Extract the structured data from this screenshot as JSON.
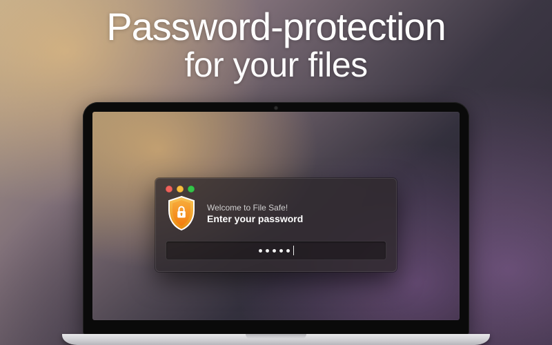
{
  "hero": {
    "line1": "Password-protection",
    "line2": "for your files"
  },
  "dialog": {
    "welcome": "Welcome to File Safe!",
    "prompt": "Enter your password",
    "password_mask_length": 5,
    "icon": "shield-lock-icon",
    "traffic": {
      "close": "red",
      "minimize": "yellow",
      "zoom": "green"
    }
  },
  "colors": {
    "shield_outer": "#f6a11c",
    "shield_inner": "#ff8a00",
    "shield_border": "#ffffff"
  }
}
